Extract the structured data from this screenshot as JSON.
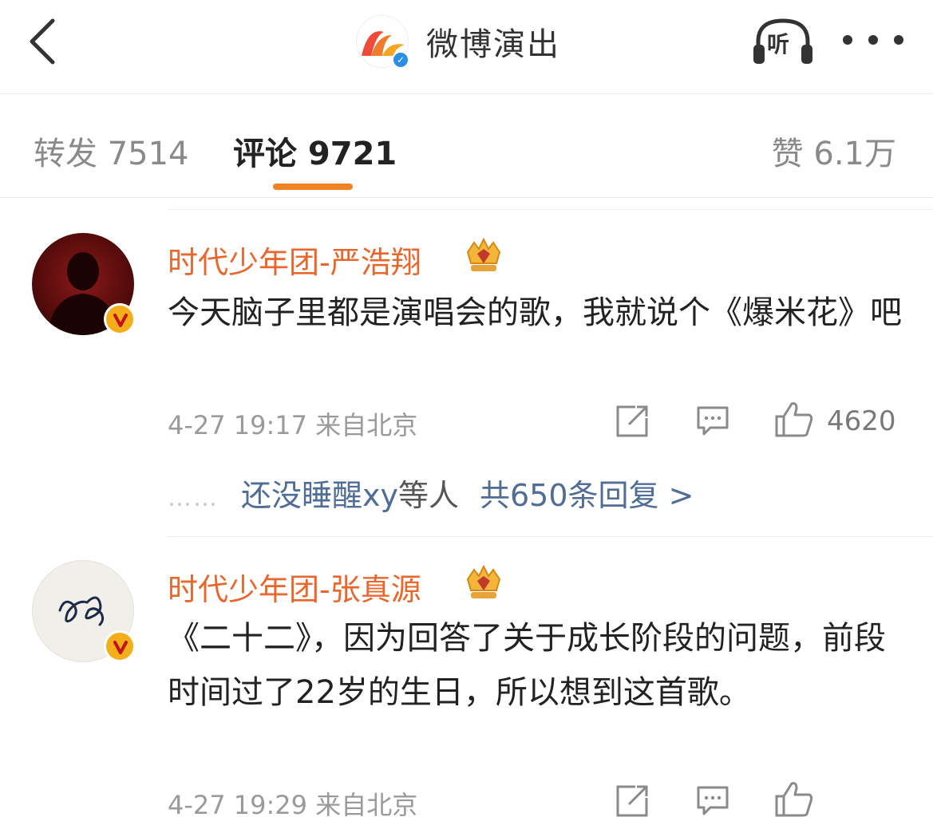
{
  "header": {
    "account_name": "微博演出",
    "listen_label": "听"
  },
  "tabs": {
    "repost": "转发 7514",
    "comment": "评论 9721",
    "like": "赞 6.1万"
  },
  "comments": [
    {
      "author": "时代少年团-严浩翔",
      "text": "今天脑子里都是演唱会的歌，我就说个《爆米花》吧",
      "meta": "4-27 19:17 来自北京",
      "likes": "4620",
      "replies": {
        "dots": "……",
        "who": "还没睡醒xy",
        "others": "等人",
        "total": "共650条回复 >"
      }
    },
    {
      "author": "时代少年团-张真源",
      "text": "《二十二》，因为回答了关于成长阶段的问题，前段时间过了22岁的生日，所以想到这首歌。",
      "meta": "4-27 19:29 来自北京"
    }
  ],
  "colors": {
    "accent": "#f08223",
    "author": "#e9662c",
    "link": "#4f6d96"
  }
}
